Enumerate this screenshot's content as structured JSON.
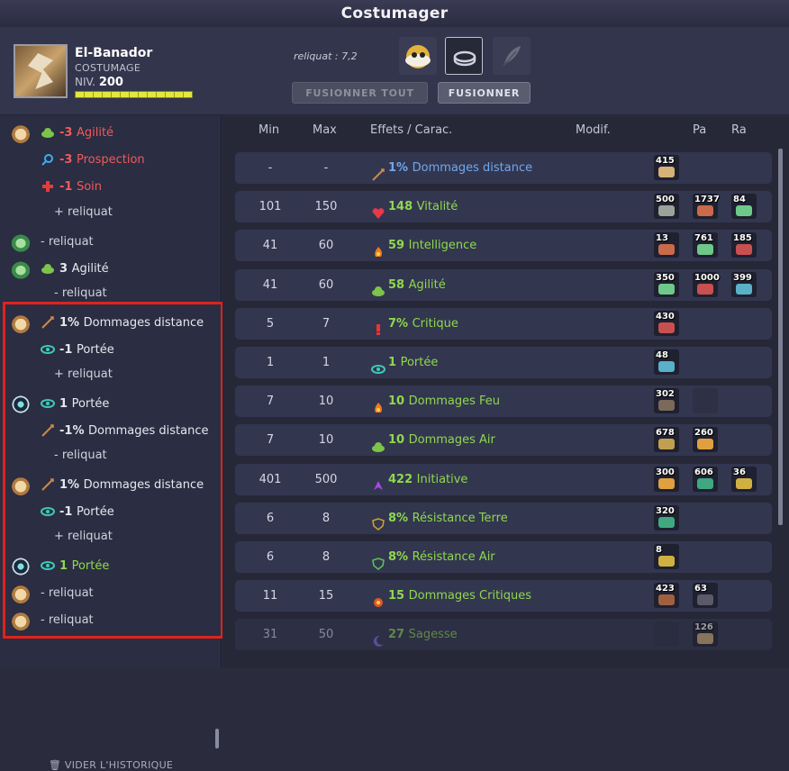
{
  "window": {
    "title": "Costumager"
  },
  "player": {
    "name": "El-Banador",
    "type": "COSTUMAGE",
    "level_label": "NIV.",
    "level": "200",
    "xp_fraction": 1.0
  },
  "reliquat": "reliquat : 7,2",
  "buttons": {
    "fuse_all": "FUSIONNER TOUT",
    "fuse": "FUSIONNER"
  },
  "history": [
    {
      "icon": "scroll-rune-icon",
      "effect_icon": "green-cloud-icon",
      "value": "-3",
      "label": "Agilité",
      "color": "neg"
    },
    {
      "icon": "",
      "effect_icon": "magnifier-icon",
      "value": "-3",
      "label": "Prospection",
      "color": "neg"
    },
    {
      "icon": "",
      "effect_icon": "red-cross-icon",
      "value": "-1",
      "label": "Soin",
      "color": "neg"
    },
    {
      "icon": "",
      "effect_icon": "",
      "value": "",
      "label": "+ reliquat",
      "color": "g"
    },
    {
      "icon": "green-rune-icon",
      "effect_icon": "",
      "value": "",
      "label": "- reliquat",
      "color": "g"
    },
    {
      "icon": "green-rune-icon",
      "effect_icon": "green-cloud-icon",
      "value": "3",
      "label": "Agilité",
      "color": "w"
    },
    {
      "icon": "",
      "effect_icon": "",
      "value": "",
      "label": "- reliquat",
      "color": "g"
    },
    {
      "icon": "scroll-rune-icon",
      "effect_icon": "bow-icon",
      "value": "1%",
      "label": "Dommages distance",
      "color": "w"
    },
    {
      "icon": "",
      "effect_icon": "eye-icon",
      "value": "-1",
      "label": "Portée",
      "color": "w"
    },
    {
      "icon": "",
      "effect_icon": "",
      "value": "",
      "label": "+ reliquat",
      "color": "g"
    },
    {
      "icon": "eye-rune-icon",
      "effect_icon": "eye-icon",
      "value": "1",
      "label": "Portée",
      "color": "w"
    },
    {
      "icon": "",
      "effect_icon": "bow-icon",
      "value": "-1%",
      "label": "Dommages distance",
      "color": "w"
    },
    {
      "icon": "",
      "effect_icon": "",
      "value": "",
      "label": "- reliquat",
      "color": "g"
    },
    {
      "icon": "scroll-rune-icon",
      "effect_icon": "bow-icon",
      "value": "1%",
      "label": "Dommages distance",
      "color": "w"
    },
    {
      "icon": "",
      "effect_icon": "eye-icon",
      "value": "-1",
      "label": "Portée",
      "color": "w"
    },
    {
      "icon": "",
      "effect_icon": "",
      "value": "",
      "label": "+ reliquat",
      "color": "g"
    },
    {
      "icon": "eye-rune-icon",
      "effect_icon": "eye-icon",
      "value": "1",
      "label": "Portée",
      "color": "pos"
    },
    {
      "icon": "scroll-rune-icon",
      "effect_icon": "",
      "value": "",
      "label": "- reliquat",
      "color": "g"
    },
    {
      "icon": "scroll-rune-icon",
      "effect_icon": "",
      "value": "",
      "label": "- reliquat",
      "color": "g"
    }
  ],
  "clear_history": "VIDER L'HISTORIQUE",
  "table": {
    "headers": {
      "min": "Min",
      "max": "Max",
      "effects": "Effets / Carac.",
      "modif": "Modif.",
      "pa": "Pa",
      "ra": "Ra"
    },
    "rows": [
      {
        "min": "-",
        "max": "-",
        "value": "1%",
        "label": "Dommages distance",
        "icon": "bow-icon",
        "runes": [
          "415"
        ],
        "color": "#6fa8ef"
      },
      {
        "min": "101",
        "max": "150",
        "value": "148",
        "label": "Vitalité",
        "icon": "heart-icon",
        "runes": [
          "500",
          "1737",
          "84"
        ],
        "color": "#8ed84e"
      },
      {
        "min": "41",
        "max": "60",
        "value": "59",
        "label": "Intelligence",
        "icon": "fire-icon",
        "runes": [
          "13",
          "761",
          "185"
        ],
        "color": "#8ed84e"
      },
      {
        "min": "41",
        "max": "60",
        "value": "58",
        "label": "Agilité",
        "icon": "green-cloud-icon",
        "runes": [
          "350",
          "1000",
          "399"
        ],
        "color": "#8ed84e"
      },
      {
        "min": "5",
        "max": "7",
        "value": "7%",
        "label": "Critique",
        "icon": "exclamation-icon",
        "runes": [
          "430"
        ],
        "color": "#8ed84e"
      },
      {
        "min": "1",
        "max": "1",
        "value": "1",
        "label": "Portée",
        "icon": "eye-icon",
        "runes": [
          "48"
        ],
        "color": "#8ed84e"
      },
      {
        "min": "7",
        "max": "10",
        "value": "10",
        "label": "Dommages Feu",
        "icon": "fire-icon",
        "runes": [
          "302",
          ""
        ],
        "color": "#8ed84e"
      },
      {
        "min": "7",
        "max": "10",
        "value": "10",
        "label": "Dommages Air",
        "icon": "green-cloud-icon",
        "runes": [
          "678",
          "260"
        ],
        "color": "#8ed84e"
      },
      {
        "min": "401",
        "max": "500",
        "value": "422",
        "label": "Initiative",
        "icon": "initiative-icon",
        "runes": [
          "300",
          "606",
          "36"
        ],
        "color": "#8ed84e"
      },
      {
        "min": "6",
        "max": "8",
        "value": "8%",
        "label": "Résistance Terre",
        "icon": "shield-earth-icon",
        "runes": [
          "320"
        ],
        "color": "#8ed84e"
      },
      {
        "min": "6",
        "max": "8",
        "value": "8%",
        "label": "Résistance Air",
        "icon": "shield-air-icon",
        "runes": [
          "8"
        ],
        "color": "#8ed84e"
      },
      {
        "min": "11",
        "max": "15",
        "value": "15",
        "label": "Dommages Critiques",
        "icon": "critical-damage-icon",
        "runes": [
          "423",
          "63"
        ],
        "color": "#8ed84e"
      },
      {
        "min": "31",
        "max": "50",
        "value": "27",
        "label": "Sagesse",
        "icon": "moon-icon",
        "runes": [
          "",
          "126"
        ],
        "color": "#8ed84e"
      }
    ]
  },
  "colors": {
    "accent_green": "#8ed84e",
    "negative_red": "#ef5b5b",
    "link_blue": "#6fa8ef",
    "highlight_box": "#e0221d"
  }
}
